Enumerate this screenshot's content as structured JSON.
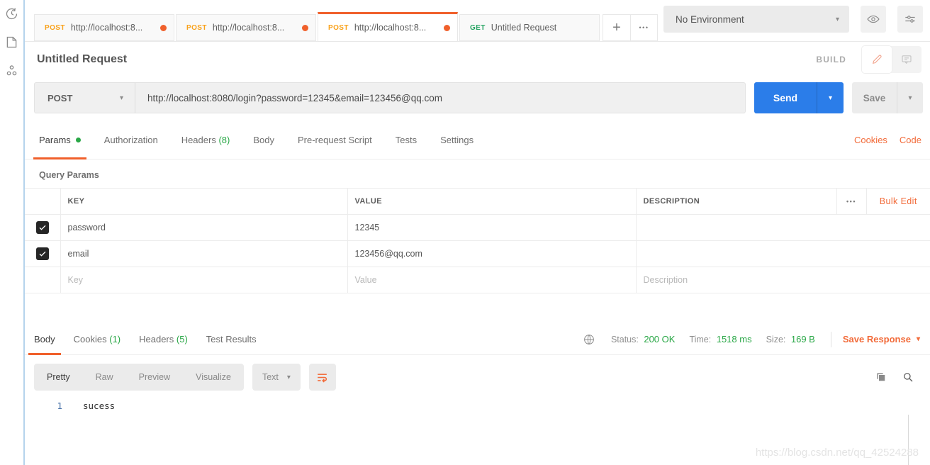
{
  "icons": {
    "caret_down": "▾",
    "plus": "+",
    "more": "•••"
  },
  "tabs": {
    "items": [
      {
        "method": "POST",
        "label": "http://localhost:8...",
        "modified": true
      },
      {
        "method": "POST",
        "label": "http://localhost:8...",
        "modified": true
      },
      {
        "method": "POST",
        "label": "http://localhost:8...",
        "modified": true
      },
      {
        "method": "GET",
        "label": "Untitled Request",
        "modified": false
      }
    ]
  },
  "environment": {
    "selected": "No Environment"
  },
  "request": {
    "title": "Untitled Request",
    "mode_label": "BUILD",
    "method": "POST",
    "url": "http://localhost:8080/login?password=12345&email=123456@qq.com",
    "send_label": "Send",
    "save_label": "Save",
    "tabs": {
      "params": "Params",
      "authorization": "Authorization",
      "headers": "Headers",
      "headers_count": "(8)",
      "body": "Body",
      "prerequest": "Pre-request Script",
      "tests": "Tests",
      "settings": "Settings"
    },
    "links": {
      "cookies": "Cookies",
      "code": "Code"
    }
  },
  "query_params": {
    "title": "Query Params",
    "columns": {
      "key": "KEY",
      "value": "VALUE",
      "description": "DESCRIPTION"
    },
    "bulk_edit": "Bulk Edit",
    "rows": [
      {
        "key": "password",
        "value": "12345",
        "description": ""
      },
      {
        "key": "email",
        "value": "123456@qq.com",
        "description": ""
      }
    ],
    "placeholder_row": {
      "key": "Key",
      "value": "Value",
      "description": "Description"
    }
  },
  "response": {
    "tabs": {
      "body": "Body",
      "cookies": "Cookies",
      "cookies_count": "(1)",
      "headers": "Headers",
      "headers_count": "(5)",
      "test_results": "Test Results"
    },
    "meta": {
      "status_label": "Status:",
      "status_value": "200 OK",
      "time_label": "Time:",
      "time_value": "1518 ms",
      "size_label": "Size:",
      "size_value": "169 B",
      "save_label": "Save Response"
    },
    "toolbar": {
      "pretty": "Pretty",
      "raw": "Raw",
      "preview": "Preview",
      "visualize": "Visualize",
      "format": "Text"
    },
    "body": {
      "line_number": "1",
      "content": "sucess"
    }
  },
  "watermark": "https://blog.csdn.net/qq_42524288"
}
